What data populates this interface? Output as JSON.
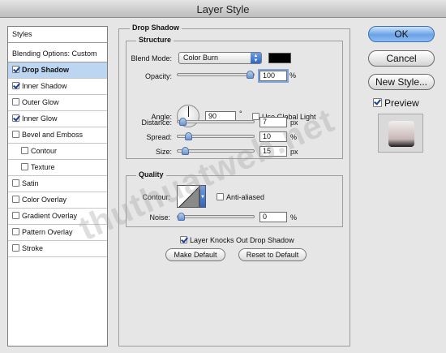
{
  "window": {
    "title": "Layer Style"
  },
  "styles_list": {
    "items": [
      {
        "label": "Styles",
        "checkbox": false,
        "checked": false,
        "selected": false,
        "indent": false
      },
      {
        "label": "Blending Options: Custom",
        "checkbox": false,
        "checked": false,
        "selected": false,
        "indent": false
      },
      {
        "label": "Drop Shadow",
        "checkbox": true,
        "checked": true,
        "selected": true,
        "indent": false
      },
      {
        "label": "Inner Shadow",
        "checkbox": true,
        "checked": true,
        "selected": false,
        "indent": false
      },
      {
        "label": "Outer Glow",
        "checkbox": true,
        "checked": false,
        "selected": false,
        "indent": false
      },
      {
        "label": "Inner Glow",
        "checkbox": true,
        "checked": true,
        "selected": false,
        "indent": false
      },
      {
        "label": "Bevel and Emboss",
        "checkbox": true,
        "checked": false,
        "selected": false,
        "indent": false
      },
      {
        "label": "Contour",
        "checkbox": true,
        "checked": false,
        "selected": false,
        "indent": true
      },
      {
        "label": "Texture",
        "checkbox": true,
        "checked": false,
        "selected": false,
        "indent": true
      },
      {
        "label": "Satin",
        "checkbox": true,
        "checked": false,
        "selected": false,
        "indent": false
      },
      {
        "label": "Color Overlay",
        "checkbox": true,
        "checked": false,
        "selected": false,
        "indent": false
      },
      {
        "label": "Gradient Overlay",
        "checkbox": true,
        "checked": false,
        "selected": false,
        "indent": false
      },
      {
        "label": "Pattern Overlay",
        "checkbox": true,
        "checked": false,
        "selected": false,
        "indent": false
      },
      {
        "label": "Stroke",
        "checkbox": true,
        "checked": false,
        "selected": false,
        "indent": false
      }
    ]
  },
  "drop_shadow": {
    "title": "Drop Shadow",
    "structure": {
      "title": "Structure",
      "blend_mode_label": "Blend Mode:",
      "blend_mode_value": "Color Burn",
      "shadow_color": "#000000",
      "opacity_label": "Opacity:",
      "opacity_value": "100",
      "opacity_fraction": 1.0,
      "percent": "%",
      "angle_label": "Angle:",
      "angle_value": "90",
      "degree": "°",
      "use_global_light_label": "Use Global Light",
      "use_global_light_checked": false,
      "distance_label": "Distance:",
      "distance_value": "7",
      "distance_fraction": 0.02,
      "spread_label": "Spread:",
      "spread_value": "10",
      "spread_fraction": 0.1,
      "size_label": "Size:",
      "size_value": "15",
      "size_fraction": 0.06,
      "px": "px"
    },
    "quality": {
      "title": "Quality",
      "contour_label": "Contour:",
      "anti_aliased_label": "Anti-aliased",
      "anti_aliased_checked": false,
      "noise_label": "Noise:",
      "noise_value": "0",
      "noise_fraction": 0.0
    },
    "knockout_label": "Layer Knocks Out Drop Shadow",
    "knockout_checked": true,
    "make_default_label": "Make Default",
    "reset_default_label": "Reset to Default"
  },
  "buttons": {
    "ok": "OK",
    "cancel": "Cancel",
    "new_style": "New Style...",
    "preview_label": "Preview",
    "preview_checked": true
  },
  "watermark": {
    "text": "thuthuatweb.net"
  },
  "colors": {
    "selection": "#bcd6f2",
    "accent": "#3d6fb5",
    "check": "#1a3f9b"
  }
}
